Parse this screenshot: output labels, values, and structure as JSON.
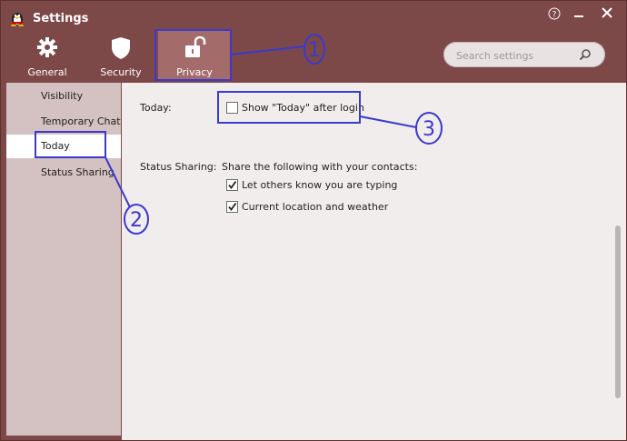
{
  "window": {
    "title": "Settings",
    "help_icon": "question-circle-icon",
    "minimize_icon": "minimize-icon",
    "close_icon": "close-icon"
  },
  "tabs": [
    {
      "label": "General",
      "icon": "gear-icon"
    },
    {
      "label": "Security",
      "icon": "shield-icon"
    },
    {
      "label": "Privacy",
      "icon": "unlock-icon",
      "active": true
    }
  ],
  "search": {
    "placeholder": "Search settings"
  },
  "sidebar": {
    "items": [
      {
        "label": "Visibility"
      },
      {
        "label": "Temporary Chat"
      },
      {
        "label": "Today",
        "active": true
      },
      {
        "label": "Status Sharing"
      }
    ]
  },
  "main": {
    "today_label": "Today:",
    "today_option": {
      "label": "Show \"Today\" after login",
      "checked": false
    },
    "status_label": "Status Sharing:",
    "status_intro": "Share the following with your contacts:",
    "status_options": [
      {
        "label": "Let others know you are typing",
        "checked": true
      },
      {
        "label": "Current location and weather",
        "checked": true
      }
    ]
  },
  "annotations": [
    "1",
    "2",
    "3"
  ],
  "colors": {
    "titlebar": "#7d4848",
    "active_tab": "#a46b6b",
    "sidebar": "#d4c1c1",
    "content": "#f1eded",
    "annotation": "#3a3acc"
  }
}
